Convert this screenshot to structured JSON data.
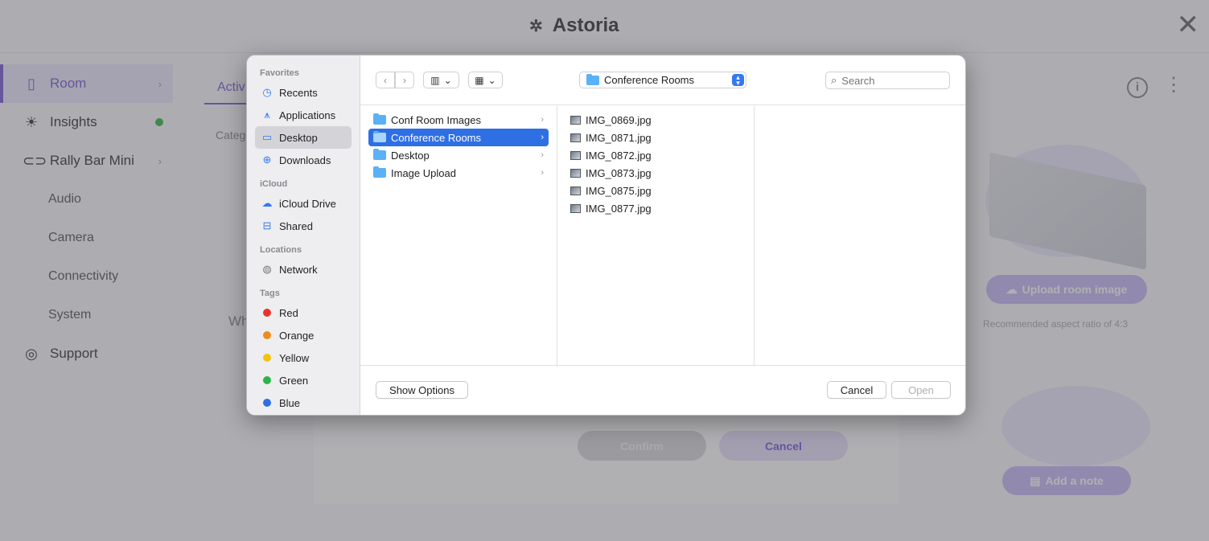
{
  "app": {
    "title": "Astoria",
    "sidebar": {
      "items": [
        {
          "label": "Room",
          "icon": "room-icon"
        },
        {
          "label": "Insights",
          "icon": "lightbulb-icon"
        },
        {
          "label": "Rally Bar Mini",
          "icon": "camera-bar-icon"
        },
        {
          "label": "Audio"
        },
        {
          "label": "Camera"
        },
        {
          "label": "Connectivity"
        },
        {
          "label": "System"
        },
        {
          "label": "Support",
          "icon": "lifebuoy-icon"
        }
      ]
    },
    "tab_fragment": "Activ",
    "category_fragment": "Categ",
    "wh_fragment": "Wh",
    "confirm_label": "Confirm",
    "cancel_label": "Cancel",
    "upload_label": "Upload room image",
    "recommended_text": "Recommended aspect ratio of 4:3",
    "note_label": "Add a note",
    "accent_color": "#7a5ad8"
  },
  "dialog": {
    "sidebar": {
      "favorites_title": "Favorites",
      "favorites": [
        {
          "label": "Recents",
          "icon": "clock-icon"
        },
        {
          "label": "Applications",
          "icon": "applications-icon"
        },
        {
          "label": "Desktop",
          "icon": "desktop-icon",
          "selected": true
        },
        {
          "label": "Downloads",
          "icon": "download-icon"
        }
      ],
      "icloud_title": "iCloud",
      "icloud": [
        {
          "label": "iCloud Drive",
          "icon": "cloud-icon"
        },
        {
          "label": "Shared",
          "icon": "shared-folder-icon"
        }
      ],
      "locations_title": "Locations",
      "locations": [
        {
          "label": "Network",
          "icon": "globe-icon"
        }
      ],
      "tags_title": "Tags",
      "tags": [
        {
          "label": "Red",
          "color": "#e8332c"
        },
        {
          "label": "Orange",
          "color": "#f08a1c"
        },
        {
          "label": "Yellow",
          "color": "#f3c311"
        },
        {
          "label": "Green",
          "color": "#2db34a"
        },
        {
          "label": "Blue",
          "color": "#2f6fe4"
        }
      ]
    },
    "toolbar": {
      "location": "Conference Rooms",
      "search_placeholder": "Search"
    },
    "columns": {
      "folders": [
        {
          "name": "Conf Room Images"
        },
        {
          "name": "Conference Rooms",
          "selected": true
        },
        {
          "name": "Desktop"
        },
        {
          "name": "Image Upload"
        }
      ],
      "files": [
        {
          "name": "IMG_0869.jpg"
        },
        {
          "name": "IMG_0871.jpg"
        },
        {
          "name": "IMG_0872.jpg"
        },
        {
          "name": "IMG_0873.jpg"
        },
        {
          "name": "IMG_0875.jpg"
        },
        {
          "name": "IMG_0877.jpg"
        }
      ]
    },
    "footer": {
      "show_options": "Show Options",
      "cancel": "Cancel",
      "open": "Open"
    }
  }
}
